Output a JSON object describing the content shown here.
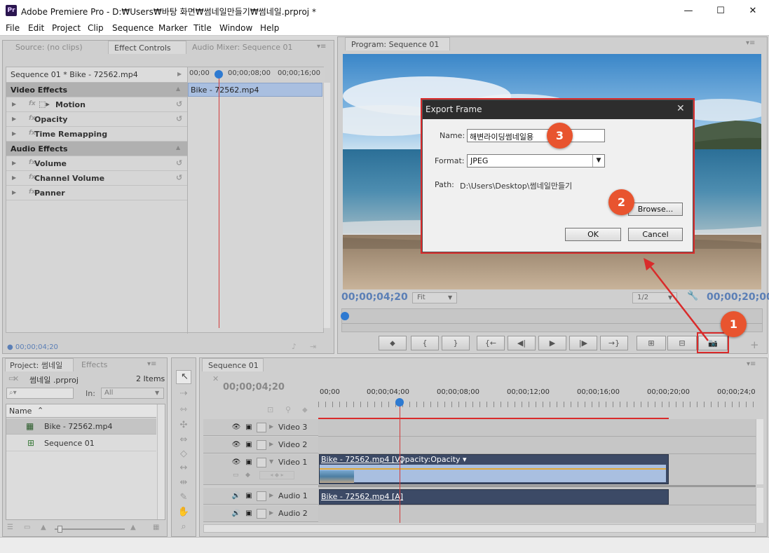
{
  "app": {
    "logo": "Pr",
    "title": "Adobe Premiere Pro - D:₩Users₩바탕 화면₩썸네일만들기₩썸네일.prproj *",
    "controls": {
      "minimize": "—",
      "maximize": "☐",
      "close": "✕"
    }
  },
  "menu": [
    "File",
    "Edit",
    "Project",
    "Clip",
    "Sequence",
    "Marker",
    "Title",
    "Window",
    "Help"
  ],
  "source_panel": {
    "tabs": [
      "Source: (no clips)",
      "Effect Controls",
      "Audio Mixer: Sequence 01"
    ],
    "clip_header": "Sequence 01 * Bike - 72562.mp4",
    "ruler": [
      "00;00",
      "00;00;08;00",
      "00;00;16;00"
    ],
    "clip_bar": "Bike - 72562.mp4",
    "sections": [
      {
        "label": "Video Effects",
        "type": "header"
      },
      {
        "label": "Motion",
        "type": "effect",
        "reset": true
      },
      {
        "label": "Opacity",
        "type": "effect",
        "reset": true
      },
      {
        "label": "Time Remapping",
        "type": "effect",
        "reset": false
      },
      {
        "label": "Audio Effects",
        "type": "header"
      },
      {
        "label": "Volume",
        "type": "effect",
        "reset": true
      },
      {
        "label": "Channel Volume",
        "type": "effect",
        "reset": true
      },
      {
        "label": "Panner",
        "type": "effect",
        "reset": false
      }
    ],
    "timecode": "00;00;04;20"
  },
  "program": {
    "tab": "Program: Sequence 01",
    "timecode_left": "00;00;04;20",
    "fit": "Fit",
    "resolution": "1/2",
    "timecode_right": "00;00;20;00",
    "transport": [
      "marker",
      "in-point",
      "out-point",
      "go-to-in",
      "step-back",
      "play",
      "step-forward",
      "go-to-out",
      "lift",
      "extract",
      "export-frame"
    ]
  },
  "dialog": {
    "title": "Export Frame",
    "name_label": "Name:",
    "name_value": "해변라이딩썸네일용",
    "format_label": "Format:",
    "format_value": "JPEG",
    "path_label": "Path:",
    "path_value": "D:\\Users\\Desktop\\썸네일만들기",
    "browse": "Browse...",
    "ok": "OK",
    "cancel": "Cancel"
  },
  "annotations": {
    "badges": [
      "1",
      "2",
      "3"
    ],
    "color": "#e8542f",
    "highlight": "#d92b2b"
  },
  "project": {
    "tabs": [
      "Project: 썸네일",
      "Effects"
    ],
    "file": "썸네일 .prproj",
    "count": "2 Items",
    "in_label": "In:",
    "in_value": "All",
    "column": "Name",
    "items": [
      "Bike - 72562.mp4",
      "Sequence 01"
    ]
  },
  "timeline": {
    "tab": "Sequence 01",
    "timecode": "00;00;04;20",
    "ruler": [
      "00;00",
      "00;00;04;00",
      "00;00;08;00",
      "00;00;12;00",
      "00;00;16;00",
      "00;00;20;00",
      "00;00;24;0"
    ],
    "tracks": [
      "Video 3",
      "Video 2",
      "Video 1",
      "Audio 1",
      "Audio 2"
    ],
    "video_clip": "Bike - 72562.mp4 [V]",
    "opacity_label": "Opacity:Opacity",
    "audio_clip": "Bike - 72562.mp4 [A]"
  }
}
